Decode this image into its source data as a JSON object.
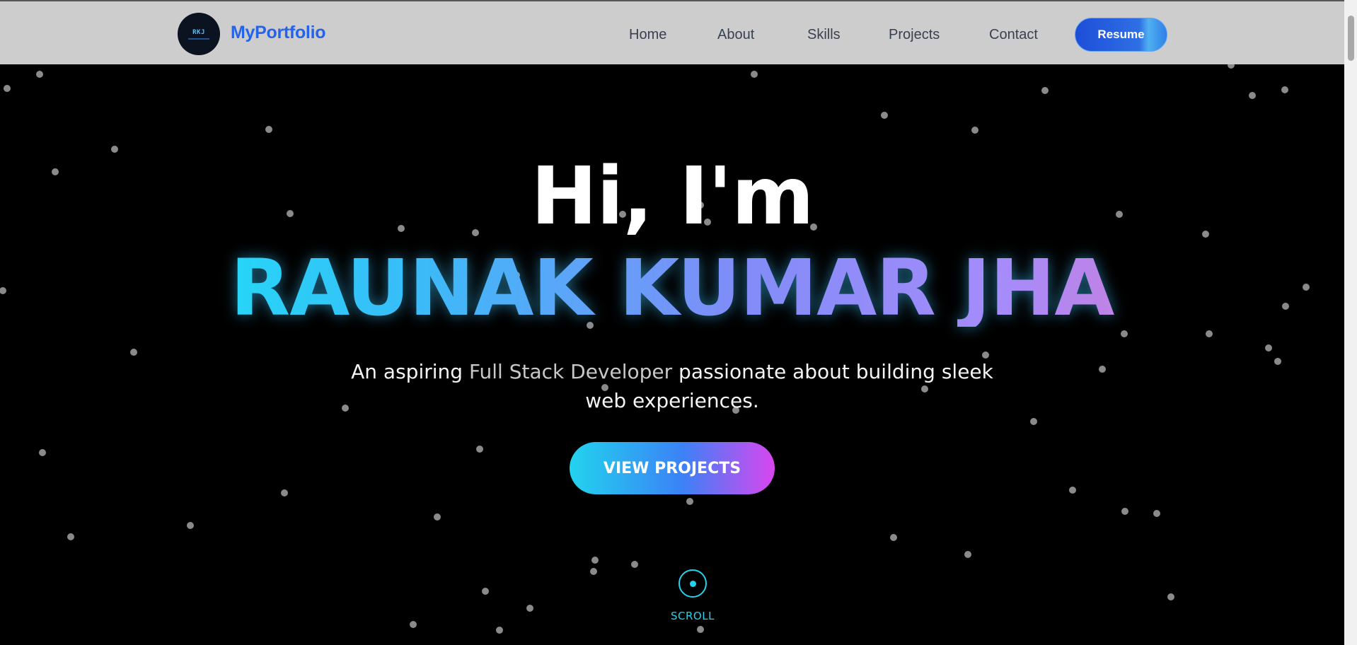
{
  "nav": {
    "logo_text": "RKJ",
    "brand": "MyPortfolio",
    "links": [
      "Home",
      "About",
      "Skills",
      "Projects",
      "Contact"
    ],
    "resume_label": "Resume"
  },
  "hero": {
    "greeting": "Hi, I'm",
    "name": "RAUNAK KUMAR JHA",
    "tagline_before": "An aspiring ",
    "tagline_highlight": "Full Stack Developer",
    "tagline_after": " passionate about building sleek web experiences.",
    "cta_label": "VIEW PROJECTS",
    "scroll_label": "SCROLL"
  },
  "colors": {
    "navbar_bg": "#cdcdcd",
    "brand": "#2563eb",
    "accent_cyan": "#22d3ee",
    "accent_pink": "#d946ef",
    "background": "#000000"
  },
  "icons": {
    "scroll_indicator": "circle-dot-icon",
    "logo": "rkj-logo"
  }
}
